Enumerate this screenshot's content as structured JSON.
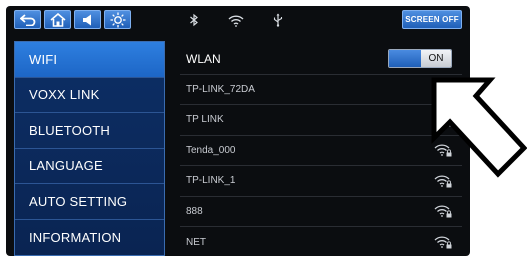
{
  "topbar": {
    "buttons": [
      {
        "name": "back",
        "icon": "back-icon"
      },
      {
        "name": "home",
        "icon": "home-icon"
      },
      {
        "name": "volume",
        "icon": "speaker-icon"
      },
      {
        "name": "brightness",
        "icon": "brightness-icon"
      }
    ],
    "status_icons": [
      "bluetooth-icon",
      "wifi-icon",
      "usb-icon"
    ],
    "screen_off_label": "SCREEN OFF"
  },
  "sidebar": {
    "items": [
      {
        "label": "WIFI",
        "active": true
      },
      {
        "label": "VOXX LINK",
        "active": false
      },
      {
        "label": "BLUETOOTH",
        "active": false
      },
      {
        "label": "LANGUAGE",
        "active": false
      },
      {
        "label": "AUTO SETTING",
        "active": false
      },
      {
        "label": "INFORMATION",
        "active": false
      }
    ]
  },
  "wlan": {
    "label": "WLAN",
    "toggle_state": "ON"
  },
  "networks": [
    {
      "ssid": "TP-LINK_72DA",
      "icon": "wifi-lock-icon"
    },
    {
      "ssid": "TP LINK",
      "icon": "wifi-lock-icon"
    },
    {
      "ssid": "Tenda_000",
      "icon": "wifi-lock-icon"
    },
    {
      "ssid": "TP-LINK_1",
      "icon": "wifi-lock-icon"
    },
    {
      "ssid": "888",
      "icon": "wifi-lock-icon"
    },
    {
      "ssid": "NET",
      "icon": "wifi-lock-icon"
    }
  ],
  "colors": {
    "accent": "#2e7fe0",
    "sidebar_bg": "#0d2f66",
    "screen_bg": "#0b0d10"
  }
}
